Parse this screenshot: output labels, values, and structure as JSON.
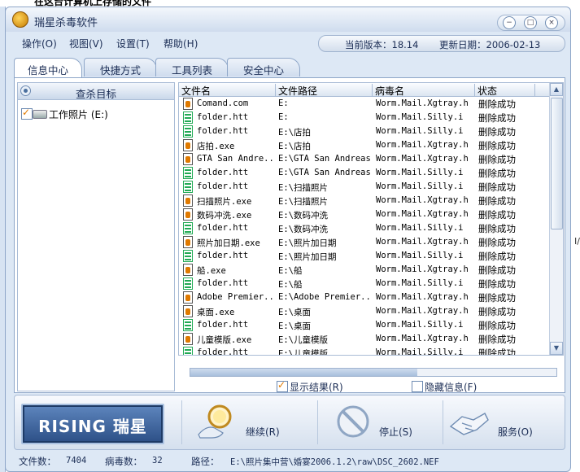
{
  "background_text": "在这台计算机上存储的文件",
  "edge_text": "I/",
  "title": "瑞星杀毒软件",
  "window_controls": {
    "minimize": "−",
    "maximize": "□",
    "close": "×"
  },
  "menu": [
    {
      "label": "操作(O)"
    },
    {
      "label": "视图(V)"
    },
    {
      "label": "设置(T)"
    },
    {
      "label": "帮助(H)"
    }
  ],
  "version": {
    "label": "当前版本：18.14",
    "date_label": "更新日期：2006-02-13"
  },
  "tabs": [
    {
      "label": "信息中心",
      "active": true
    },
    {
      "label": "快捷方式"
    },
    {
      "label": "工具列表"
    },
    {
      "label": "安全中心"
    }
  ],
  "scan_target": {
    "title": "查杀目标",
    "item": "工作照片 (E:)"
  },
  "table": {
    "columns": [
      "文件名",
      "文件路径",
      "病毒名",
      "状态"
    ],
    "rows": [
      {
        "icon": "exe",
        "name": "Comand.com",
        "path": "E:",
        "virus": "Worm.Mail.Xgtray.h",
        "status": "删除成功"
      },
      {
        "icon": "htt",
        "name": "folder.htt",
        "path": "E:",
        "virus": "Worm.Mail.Silly.i",
        "status": "删除成功"
      },
      {
        "icon": "htt",
        "name": "folder.htt",
        "path": "E:\\店拍",
        "virus": "Worm.Mail.Silly.i",
        "status": "删除成功"
      },
      {
        "icon": "exe",
        "name": "店拍.exe",
        "path": "E:\\店拍",
        "virus": "Worm.Mail.Xgtray.h",
        "status": "删除成功"
      },
      {
        "icon": "exe",
        "name": "GTA San Andre...",
        "path": "E:\\GTA San Andreas",
        "virus": "Worm.Mail.Xgtray.h",
        "status": "删除成功"
      },
      {
        "icon": "htt",
        "name": "folder.htt",
        "path": "E:\\GTA San Andreas",
        "virus": "Worm.Mail.Silly.i",
        "status": "删除成功"
      },
      {
        "icon": "htt",
        "name": "folder.htt",
        "path": "E:\\扫描照片",
        "virus": "Worm.Mail.Silly.i",
        "status": "删除成功"
      },
      {
        "icon": "exe",
        "name": "扫描照片.exe",
        "path": "E:\\扫描照片",
        "virus": "Worm.Mail.Xgtray.h",
        "status": "删除成功"
      },
      {
        "icon": "exe",
        "name": "数码冲洗.exe",
        "path": "E:\\数码冲洗",
        "virus": "Worm.Mail.Xgtray.h",
        "status": "删除成功"
      },
      {
        "icon": "htt",
        "name": "folder.htt",
        "path": "E:\\数码冲洗",
        "virus": "Worm.Mail.Silly.i",
        "status": "删除成功"
      },
      {
        "icon": "exe",
        "name": "照片加日期.exe",
        "path": "E:\\照片加日期",
        "virus": "Worm.Mail.Xgtray.h",
        "status": "删除成功"
      },
      {
        "icon": "htt",
        "name": "folder.htt",
        "path": "E:\\照片加日期",
        "virus": "Worm.Mail.Silly.i",
        "status": "删除成功"
      },
      {
        "icon": "exe",
        "name": "船.exe",
        "path": "E:\\船",
        "virus": "Worm.Mail.Xgtray.h",
        "status": "删除成功"
      },
      {
        "icon": "htt",
        "name": "folder.htt",
        "path": "E:\\船",
        "virus": "Worm.Mail.Silly.i",
        "status": "删除成功"
      },
      {
        "icon": "exe",
        "name": "Adobe Premier...",
        "path": "E:\\Adobe Premier...",
        "virus": "Worm.Mail.Xgtray.h",
        "status": "删除成功"
      },
      {
        "icon": "exe",
        "name": "桌面.exe",
        "path": "E:\\桌面",
        "virus": "Worm.Mail.Xgtray.h",
        "status": "删除成功"
      },
      {
        "icon": "htt",
        "name": "folder.htt",
        "path": "E:\\桌面",
        "virus": "Worm.Mail.Silly.i",
        "status": "删除成功"
      },
      {
        "icon": "exe",
        "name": "儿童模版.exe",
        "path": "E:\\儿童模版",
        "virus": "Worm.Mail.Xgtray.h",
        "status": "删除成功"
      },
      {
        "icon": "htt",
        "name": "folder.htt",
        "path": "E:\\儿童模版",
        "virus": "Worm.Mail.Silly.i",
        "status": "删除成功"
      }
    ]
  },
  "scan_progress": 0.62,
  "options": {
    "show_results": {
      "label": "显示结果(R)",
      "checked": true
    },
    "hide_info": {
      "label": "隐藏信息(F)",
      "checked": false
    }
  },
  "logo_text": "RISING 瑞星",
  "buttons": {
    "continue": "继续(R)",
    "stop": "停止(S)",
    "service": "服务(O)"
  },
  "status": {
    "file_count_label": "文件数：",
    "file_count": "7404",
    "virus_count_label": "病毒数：",
    "virus_count": "32",
    "path_label": "路径：",
    "path": "E:\\照片集中营\\婚宴2006.1.2\\raw\\DSC_2602.NEF"
  },
  "colors": {
    "window_bg": "#dde8f5",
    "accent": "#2c4f86",
    "check": "#e07a00"
  }
}
